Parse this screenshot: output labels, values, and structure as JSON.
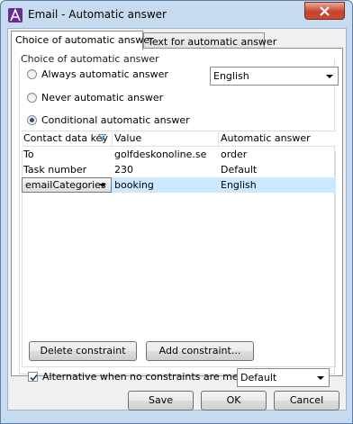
{
  "window": {
    "title": "Email - Automatic answer"
  },
  "tabs": [
    {
      "label": "Choice of automatic answer",
      "active": true
    },
    {
      "label": "Text for automatic answer",
      "active": false
    }
  ],
  "group": {
    "label": "Choice of automatic answer"
  },
  "radios": {
    "always": {
      "label": "Always automatic answer",
      "checked": false
    },
    "never": {
      "label": "Never automatic answer",
      "checked": false
    },
    "conditional": {
      "label": "Conditional automatic answer",
      "checked": true
    }
  },
  "language_select": {
    "value": "English"
  },
  "table": {
    "columns": [
      "Contact data key",
      "Value",
      "Automatic answer"
    ],
    "rows": [
      {
        "key": "To",
        "value": "golfdeskonoline.se",
        "answer": "order"
      },
      {
        "key": "Task number",
        "value": "230",
        "answer": "Default"
      },
      {
        "key": "emailCategories",
        "value": "booking",
        "answer": "English",
        "selected": true
      }
    ]
  },
  "buttons": {
    "delete_constraint": "Delete constraint",
    "add_constraint": "Add constraint...",
    "save": "Save",
    "ok": "OK",
    "cancel": "Cancel"
  },
  "fallback": {
    "label": "Alternative when no constraints are met",
    "checked": true,
    "value": "Default"
  },
  "colors": {
    "selection": "#cce8ff",
    "frame": "#c6daf0",
    "close": "#c7442e"
  }
}
